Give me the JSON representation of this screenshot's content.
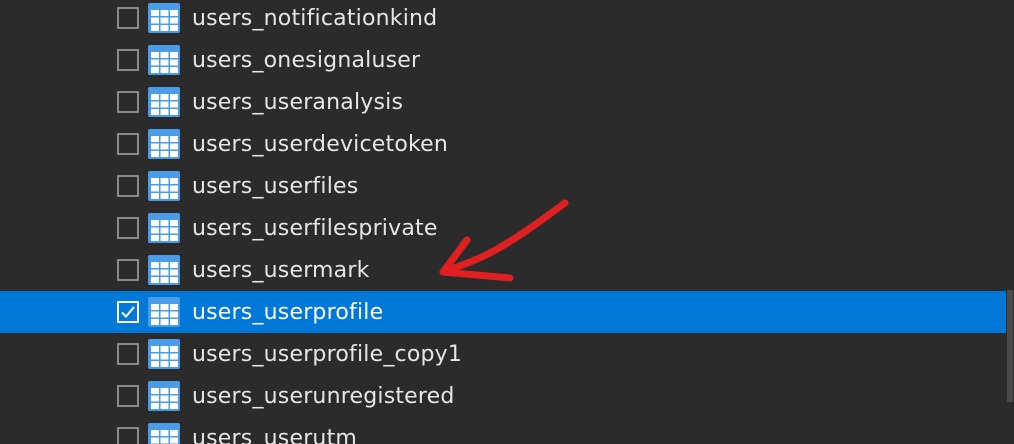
{
  "tables": [
    {
      "name": "users_notificationkind",
      "checked": false,
      "selected": false
    },
    {
      "name": "users_onesignaluser",
      "checked": false,
      "selected": false
    },
    {
      "name": "users_useranalysis",
      "checked": false,
      "selected": false
    },
    {
      "name": "users_userdevicetoken",
      "checked": false,
      "selected": false
    },
    {
      "name": "users_userfiles",
      "checked": false,
      "selected": false
    },
    {
      "name": "users_userfilesprivate",
      "checked": false,
      "selected": false
    },
    {
      "name": "users_usermark",
      "checked": false,
      "selected": false
    },
    {
      "name": "users_userprofile",
      "checked": true,
      "selected": true
    },
    {
      "name": "users_userprofile_copy1",
      "checked": false,
      "selected": false
    },
    {
      "name": "users_userunregistered",
      "checked": false,
      "selected": false
    },
    {
      "name": "users_userutm",
      "checked": false,
      "selected": false
    }
  ],
  "colors": {
    "background": "#2b2b2b",
    "selection": "#0078d7",
    "icon": "#4a9be8",
    "annotation": "#e02020"
  },
  "icons": {
    "row_icon": "table-icon",
    "check": "checkmark-icon",
    "annotation": "red-arrow-icon"
  }
}
